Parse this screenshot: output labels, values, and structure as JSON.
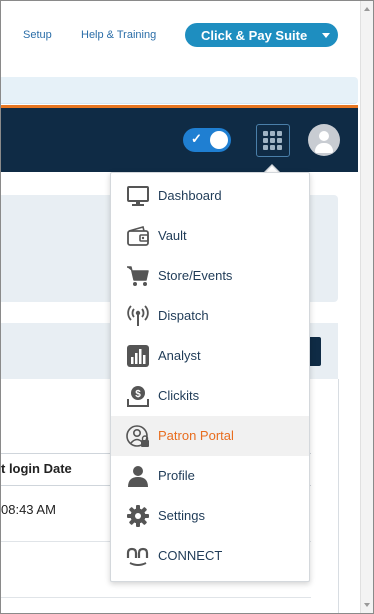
{
  "top_links": {
    "setup": "Setup",
    "help": "Help & Training"
  },
  "suite_button": {
    "label": "Click & Pay Suite"
  },
  "table": {
    "header": "t login Date",
    "cell": "08:43 AM"
  },
  "menu": {
    "items": [
      {
        "label": "Dashboard",
        "icon": "monitor-icon"
      },
      {
        "label": "Vault",
        "icon": "wallet-icon"
      },
      {
        "label": "Store/Events",
        "icon": "cart-icon"
      },
      {
        "label": "Dispatch",
        "icon": "broadcast-icon"
      },
      {
        "label": "Analyst",
        "icon": "bar-chart-icon"
      },
      {
        "label": "Clickits",
        "icon": "coin-tray-icon"
      },
      {
        "label": "Patron Portal",
        "icon": "user-lock-icon",
        "active": true
      },
      {
        "label": "Profile",
        "icon": "user-icon"
      },
      {
        "label": "Settings",
        "icon": "gear-icon"
      },
      {
        "label": "CONNECT",
        "icon": "connect-logo-icon"
      }
    ]
  },
  "colors": {
    "brand_blue": "#1e8ec0",
    "navy": "#0f2b45",
    "accent_orange": "#e87722",
    "active_text": "#e86d1f"
  }
}
